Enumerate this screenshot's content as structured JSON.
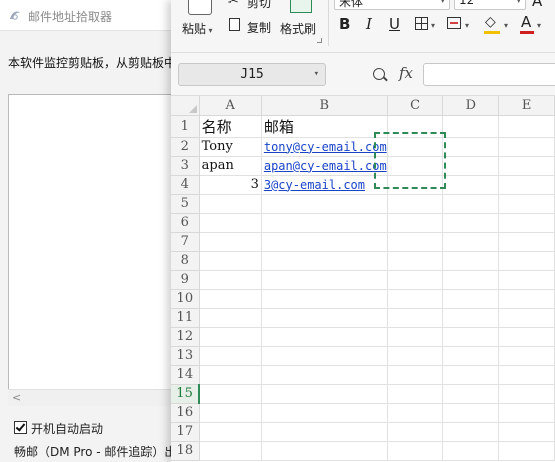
{
  "app": {
    "title": "邮件地址拾取器",
    "description": "本软件监控剪贴板，从剪贴板中",
    "scroll_left_glyph": "<",
    "autostart_label": "开机自动启动",
    "footer_text": "畅邮（DM Pro - 邮件追踪）出品"
  },
  "ribbon": {
    "cut_label": "剪切",
    "copy_label": "复制",
    "paste_label": "粘贴",
    "format_painter_label": "格式刷",
    "font_name": "宋体",
    "font_size": "12",
    "bold": "B",
    "italic": "I",
    "underline": "U",
    "font_color_glyph": "A",
    "grow_font_glyph": "A"
  },
  "formula_bar": {
    "name_box": "J15",
    "fx": "fx",
    "formula": ""
  },
  "sheet": {
    "columns": [
      "A",
      "B",
      "C",
      "D",
      "E"
    ],
    "active_row": "15",
    "rows": [
      {
        "n": "1",
        "a": "名称",
        "b": "邮箱"
      },
      {
        "n": "2",
        "a": "Tony",
        "b": "tony@cy-email.com"
      },
      {
        "n": "3",
        "a": "apan",
        "b": "apan@cy-email.com"
      },
      {
        "n": "4",
        "a": "3",
        "b": "3@cy-email.com"
      },
      {
        "n": "5",
        "a": "",
        "b": ""
      },
      {
        "n": "6",
        "a": "",
        "b": ""
      },
      {
        "n": "7",
        "a": "",
        "b": ""
      },
      {
        "n": "8",
        "a": "",
        "b": ""
      },
      {
        "n": "9",
        "a": "",
        "b": ""
      },
      {
        "n": "10",
        "a": "",
        "b": ""
      },
      {
        "n": "11",
        "a": "",
        "b": ""
      },
      {
        "n": "12",
        "a": "",
        "b": ""
      },
      {
        "n": "13",
        "a": "",
        "b": ""
      },
      {
        "n": "14",
        "a": "",
        "b": ""
      },
      {
        "n": "15",
        "a": "",
        "b": ""
      },
      {
        "n": "16",
        "a": "",
        "b": ""
      },
      {
        "n": "17",
        "a": "",
        "b": ""
      },
      {
        "n": "18",
        "a": "",
        "b": ""
      }
    ]
  },
  "colors": {
    "accent_green": "#2e8b57",
    "link_blue": "#1a44c8"
  }
}
